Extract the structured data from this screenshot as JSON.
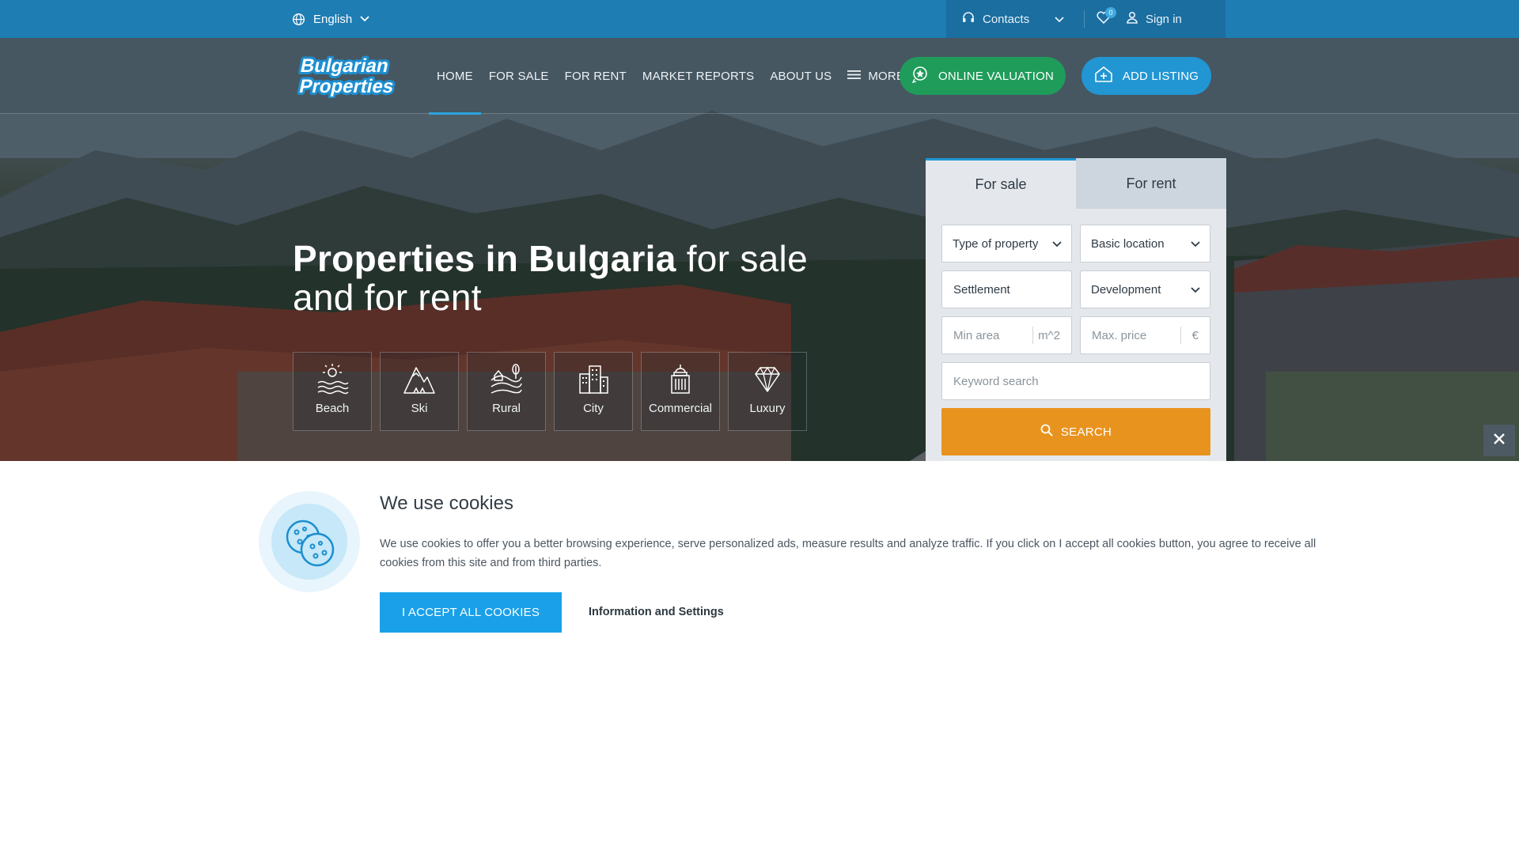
{
  "topbar": {
    "language": "English",
    "contacts": "Contacts",
    "favorites_count": "0",
    "sign_in": "Sign in"
  },
  "logo": {
    "line1": "Bulgarian",
    "line2": "Properties"
  },
  "nav": {
    "items": [
      "HOME",
      "FOR SALE",
      "FOR RENT",
      "MARKET REPORTS",
      "ABOUT US",
      "MORE"
    ],
    "active": "HOME",
    "valuation_button": "ONLINE VALUATION",
    "listing_button": "ADD LISTING"
  },
  "hero": {
    "headline_bold": "Properties in Bulgaria",
    "headline_light_1": " for sale",
    "headline_light_2": "and for rent"
  },
  "categories": [
    {
      "label": "Beach",
      "icon": "beach-icon"
    },
    {
      "label": "Ski",
      "icon": "mountain-icon"
    },
    {
      "label": "Rural",
      "icon": "rural-icon"
    },
    {
      "label": "City",
      "icon": "city-icon"
    },
    {
      "label": "Commercial",
      "icon": "commercial-icon"
    },
    {
      "label": "Luxury",
      "icon": "diamond-icon"
    }
  ],
  "search": {
    "tabs": [
      "For sale",
      "For rent"
    ],
    "active_tab": "For sale",
    "type_of_property": "Type of property",
    "basic_location": "Basic location",
    "settlement": "Settlement",
    "development": "Development",
    "min_area_placeholder": "Min area",
    "min_area_unit": "m^2",
    "max_price_placeholder": "Max. price",
    "max_price_unit": "€",
    "keyword_placeholder": "Keyword search",
    "search_button": "SEARCH"
  },
  "cookie": {
    "title": "We use cookies",
    "text": "We use cookies to offer you a better browsing experience, serve personalized ads, measure results and analyze traffic. If you click on I accept all cookies button, you agree to receive all cookies from this site and from third parties.",
    "accept_button": "I ACCEPT ALL COOKIES",
    "settings_link": "Information and Settings"
  },
  "colors": {
    "topbar": "#1e7db3",
    "valuation": "#1f9c5a",
    "listing": "#2196d3",
    "search": "#e9931f",
    "accept": "#1aa0e8"
  }
}
